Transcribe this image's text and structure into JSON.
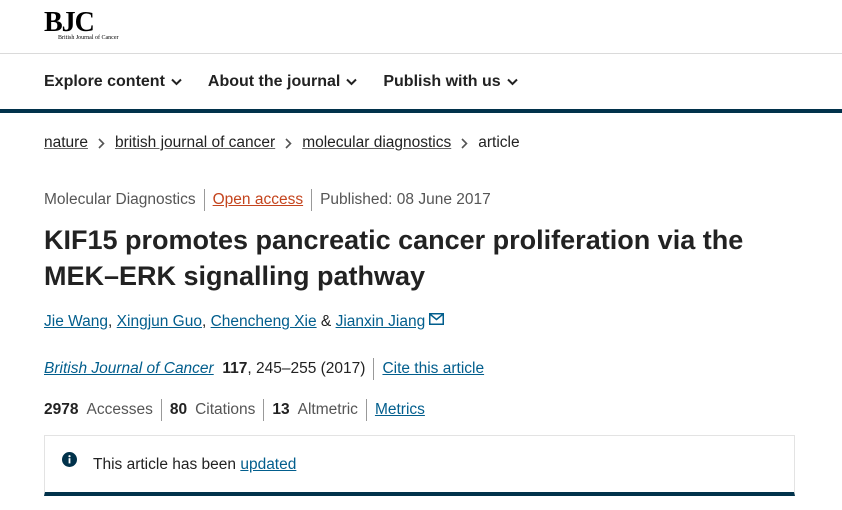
{
  "logo": {
    "main": "BJC",
    "sub": "British Journal of Cancer"
  },
  "nav": {
    "items": [
      {
        "label": "Explore content"
      },
      {
        "label": "About the journal"
      },
      {
        "label": "Publish with us"
      }
    ]
  },
  "breadcrumb": {
    "items": [
      "nature",
      "british journal of cancer",
      "molecular diagnostics"
    ],
    "current": "article"
  },
  "meta": {
    "category": "Molecular Diagnostics",
    "access": "Open access",
    "published": "Published: 08 June 2017"
  },
  "article": {
    "title_line1": "KIF15 promotes pancreatic cancer proliferation via the",
    "title_line2": "MEK–ERK signalling pathway",
    "authors": [
      "Jie Wang",
      "Xingjun Guo",
      "Chencheng Xie",
      "Jianxin Jiang"
    ],
    "author_sep": ",",
    "author_and": "&"
  },
  "citation": {
    "journal": "British Journal of Cancer",
    "volume": "117",
    "pages": ", 245–255 (2017)",
    "cite_label": "Cite this article"
  },
  "metrics": {
    "accesses_value": "2978",
    "accesses_label": "Accesses",
    "citations_value": "80",
    "citations_label": "Citations",
    "altmetric_value": "13",
    "altmetric_label": "Altmetric",
    "metrics_link": "Metrics"
  },
  "notice": {
    "text": "This article has been ",
    "link": "updated"
  },
  "colors": {
    "accent": "#01324b",
    "link": "#025e8d",
    "open_access": "#c4441d"
  }
}
